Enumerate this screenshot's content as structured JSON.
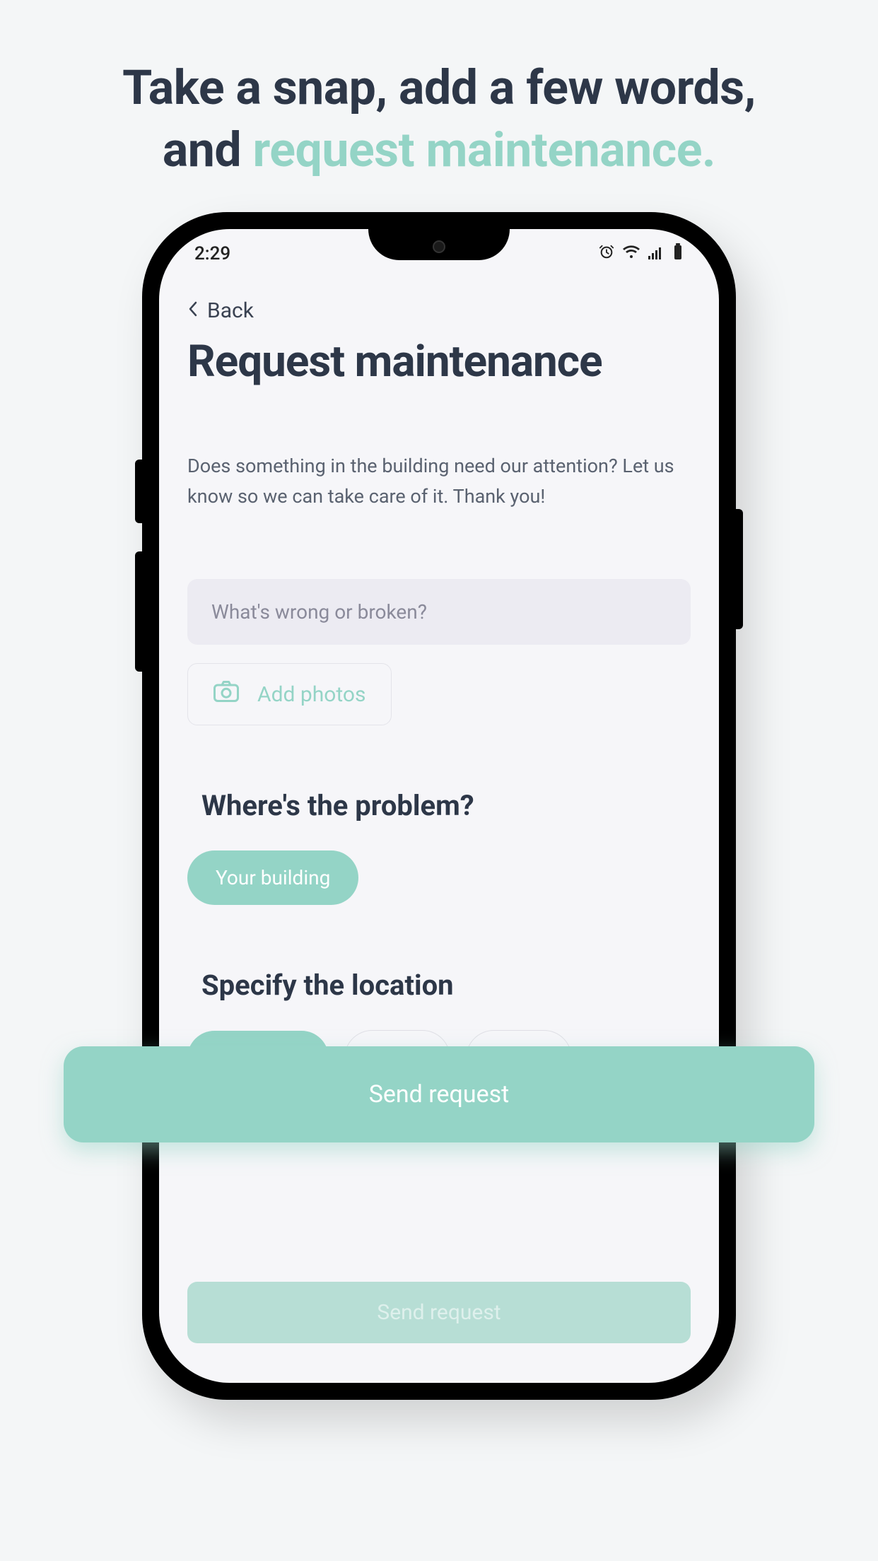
{
  "headline": {
    "line1": "Take a snap, add a few words,",
    "line2_prefix": "and ",
    "line2_accent": "request maintenance."
  },
  "status": {
    "time": "2:29"
  },
  "nav": {
    "back_label": "Back"
  },
  "page": {
    "title": "Request maintenance",
    "intro": "Does something in the building need our attention? Let us know so we can take care of it. Thank you!"
  },
  "form": {
    "issue_placeholder": "What's wrong or broken?",
    "add_photos_label": "Add photos",
    "where_heading": "Where's the problem?",
    "where_selected": "Your building",
    "specify_heading": "Specify the location",
    "send_label": "Send request"
  },
  "overlay": {
    "send_label": "Send request"
  }
}
